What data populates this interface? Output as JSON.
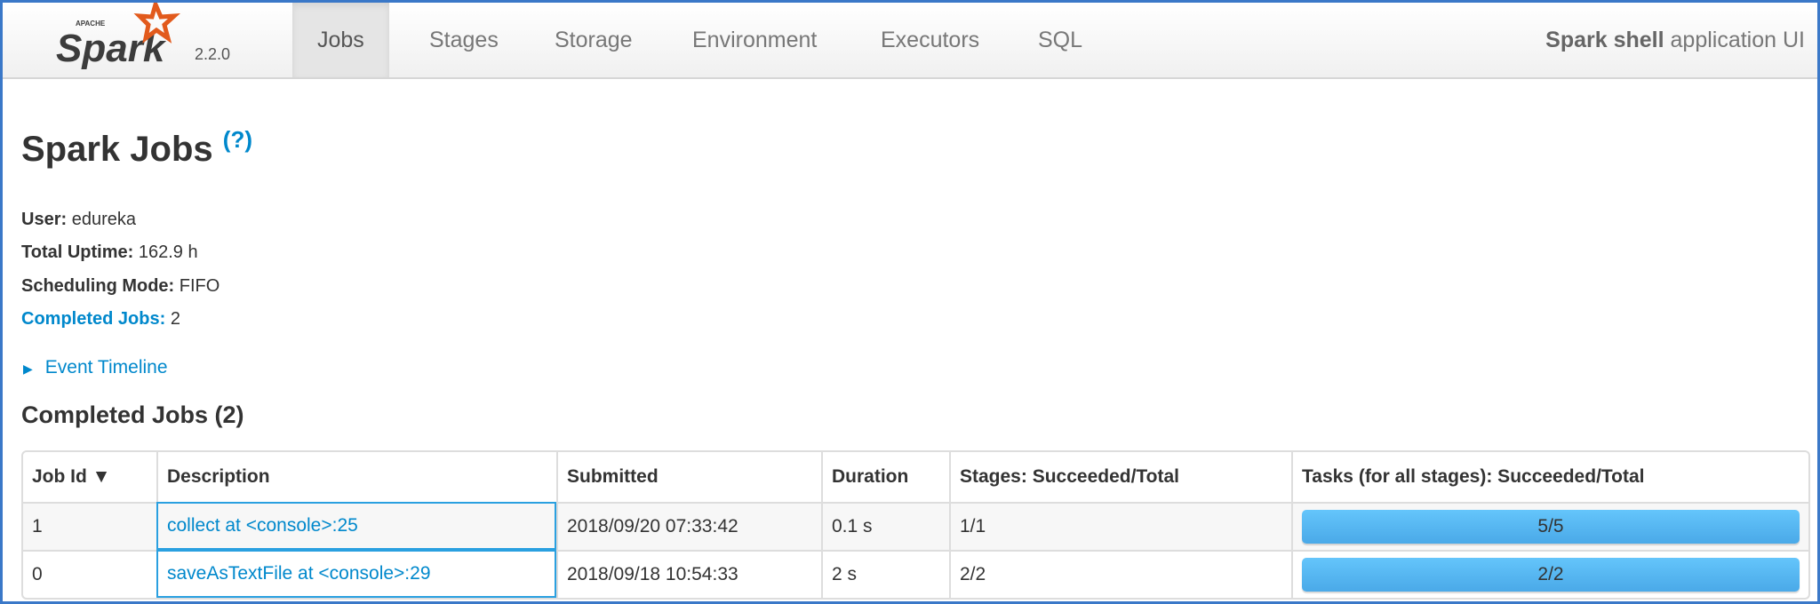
{
  "nav": {
    "brand": "Spark",
    "brand_top": "APACHE",
    "version": "2.2.0",
    "tabs": [
      {
        "label": "Jobs",
        "active": true
      },
      {
        "label": "Stages"
      },
      {
        "label": "Storage"
      },
      {
        "label": "Environment"
      },
      {
        "label": "Executors"
      },
      {
        "label": "SQL"
      }
    ],
    "app_name": "Spark shell",
    "app_suffix": " application UI"
  },
  "page": {
    "title": "Spark Jobs",
    "help": "(?)",
    "user_label": "User:",
    "user": "edureka",
    "uptime_label": "Total Uptime:",
    "uptime": "162.9 h",
    "mode_label": "Scheduling Mode:",
    "mode": "FIFO",
    "completed_label": "Completed Jobs:",
    "completed": "2",
    "timeline": "Event Timeline",
    "section": "Completed Jobs (2)"
  },
  "table": {
    "headers": [
      "Job Id ▼",
      "Description",
      "Submitted",
      "Duration",
      "Stages: Succeeded/Total",
      "Tasks (for all stages): Succeeded/Total"
    ],
    "rows": [
      {
        "id": "1",
        "desc": "collect at <console>:25",
        "submitted": "2018/09/20 07:33:42",
        "duration": "0.1 s",
        "stages": "1/1",
        "tasks": "5/5",
        "progress": 1.0
      },
      {
        "id": "0",
        "desc": "saveAsTextFile at <console>:29",
        "submitted": "2018/09/18 10:54:33",
        "duration": "2 s",
        "stages": "2/2",
        "tasks": "2/2",
        "progress": 1.0
      }
    ]
  },
  "colors": {
    "accent": "#0088cc",
    "bar": "#5ab8f2",
    "frame": "#3a78c8"
  }
}
